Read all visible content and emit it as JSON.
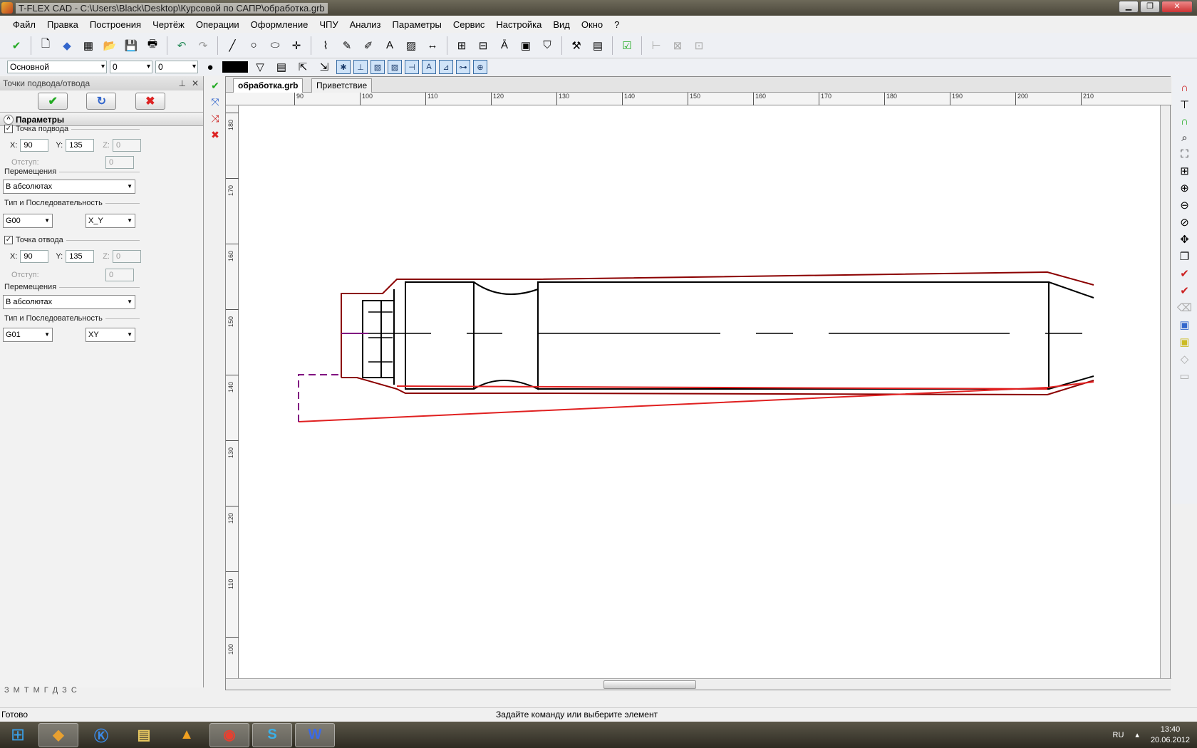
{
  "window": {
    "title": "T-FLEX CAD - C:\\Users\\Black\\Desktop\\Курсовой по САПР\\обработка.grb"
  },
  "menu": [
    "Файл",
    "Правка",
    "Построения",
    "Чертёж",
    "Операции",
    "Оформление",
    "ЧПУ",
    "Анализ",
    "Параметры",
    "Сервис",
    "Настройка",
    "Вид",
    "Окно",
    "?"
  ],
  "toolbar2": {
    "layer": "Основной",
    "level1": "0",
    "level2": "0"
  },
  "panel": {
    "title": "Точки подвода/отвода",
    "section": "Параметры",
    "approach": {
      "label": "Точка подвода",
      "checked": "✓",
      "x_label": "X:",
      "x": "90",
      "y_label": "Y:",
      "y": "135",
      "z_label": "Z:",
      "z": "0",
      "offset_label": "Отступ:",
      "offset": "0"
    },
    "move1": {
      "label": "Перемещения",
      "value": "В абсолютах"
    },
    "seq1": {
      "label": "Тип и Последовательность",
      "type": "G00",
      "order": "X_Y"
    },
    "retract": {
      "label": "Точка отвода",
      "checked": "✓",
      "x_label": "X:",
      "x": "90",
      "y_label": "Y:",
      "y": "135",
      "z_label": "Z:",
      "z": "0",
      "offset_label": "Отступ:",
      "offset": "0"
    },
    "move2": {
      "label": "Перемещения",
      "value": "В абсолютах"
    },
    "seq2": {
      "label": "Тип и Последовательность",
      "type": "G01",
      "order": "XY"
    },
    "tabs": [
      "З",
      "М",
      "Т",
      "М",
      "Г",
      "Д",
      "З",
      "С"
    ]
  },
  "doc": {
    "tab_active": "обработка.grb",
    "tab_other": "Приветствие"
  },
  "ruler_h": [
    "90",
    "100",
    "110",
    "120",
    "130",
    "140",
    "150",
    "160",
    "170",
    "180",
    "190",
    "200",
    "210"
  ],
  "ruler_v": [
    "180",
    "170",
    "160",
    "150",
    "140",
    "130",
    "120",
    "110",
    "100"
  ],
  "status": {
    "left": "Готово",
    "center": "Задайте команду или выберите элемент"
  },
  "tray": {
    "lang": "RU",
    "time": "13:40",
    "date": "20.06.2012"
  },
  "colors": {
    "contour": "#8b0000",
    "toolpath": "#e02020",
    "approach": "#800080",
    "part": "#000000"
  }
}
